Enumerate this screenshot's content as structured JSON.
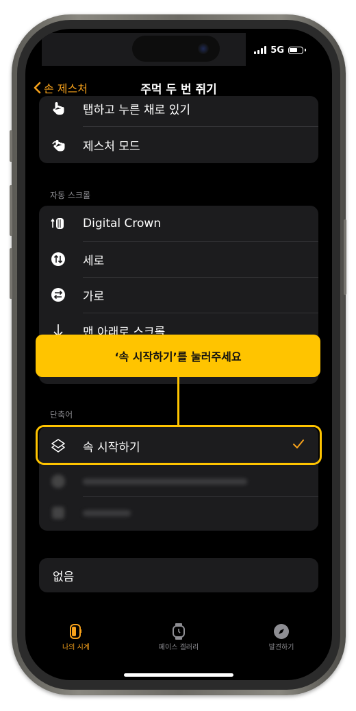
{
  "status": {
    "network": "5G"
  },
  "nav": {
    "back_label": "손 제스처",
    "title": "주먹 두 번 쥐기"
  },
  "gestures": {
    "items": [
      {
        "label": "탭하고 누른 채로 있기",
        "icon": "hand-tap-hold-icon"
      },
      {
        "label": "제스처 모드",
        "icon": "hand-gesture-icon"
      }
    ]
  },
  "auto_scroll": {
    "header": "자동 스크롤",
    "items": [
      {
        "label": "Digital Crown",
        "icon": "digital-crown-icon"
      },
      {
        "label": "세로",
        "icon": "vertical-arrows-icon"
      },
      {
        "label": "가로",
        "icon": "horizontal-arrows-icon"
      },
      {
        "label": "맨 아래로 스크롤",
        "icon": "arrow-down-icon"
      }
    ]
  },
  "callout": {
    "text": "‘속 시작하기’를 눌러주세요"
  },
  "shortcuts": {
    "header": "단축어",
    "selected": {
      "label": "속 시작하기",
      "icon": "shortcuts-layers-icon",
      "checked": true
    }
  },
  "none_option": {
    "label": "없음"
  },
  "tabs": [
    {
      "label": "나의 시계",
      "icon": "watch-icon",
      "active": true
    },
    {
      "label": "페이스 갤러리",
      "icon": "watch-face-gallery-icon",
      "active": false
    },
    {
      "label": "발견하기",
      "icon": "compass-icon",
      "active": false
    }
  ],
  "colors": {
    "accent": "#f7a21b",
    "callout": "#ffc400",
    "cell": "#1c1c1e"
  }
}
